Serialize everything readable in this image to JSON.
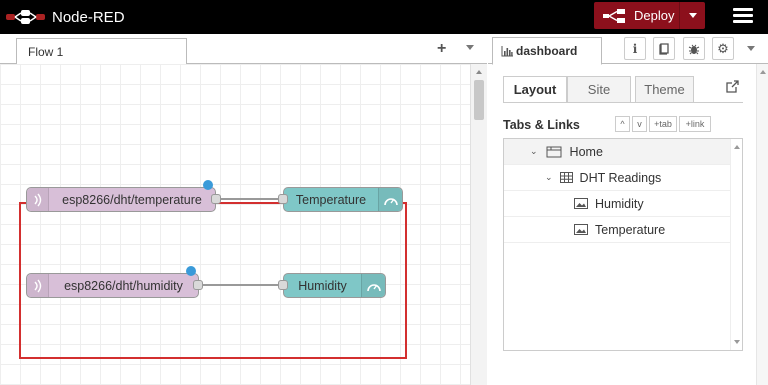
{
  "header": {
    "app_title": "Node-RED",
    "deploy_label": "Deploy"
  },
  "workspace": {
    "flow_tab": "Flow 1",
    "add_tab": "+"
  },
  "nodes": [
    {
      "label": "esp8266/dht/temperature",
      "type": "mqtt-in"
    },
    {
      "label": "Temperature",
      "type": "gauge"
    },
    {
      "label": "esp8266/dht/humidity",
      "type": "mqtt-in"
    },
    {
      "label": "Humidity",
      "type": "gauge"
    }
  ],
  "sidebar": {
    "tab_label": "dashboard",
    "sub_tabs": [
      "Layout",
      "Site",
      "Theme"
    ],
    "active_sub_tab": "Layout",
    "tabs_links_title": "Tabs & Links",
    "toolbar": {
      "collapse": "^",
      "expand": "v",
      "add_tab": "+tab",
      "add_link": "+link"
    },
    "tree": {
      "tab": "Home",
      "group": "DHT Readings",
      "widgets": [
        "Humidity",
        "Temperature"
      ]
    }
  },
  "colors": {
    "header_bg": "#000000",
    "deploy_bg": "#8c101c",
    "mqtt_node": "#d8bfd8",
    "gauge_node": "#7fc7c7",
    "selection": "#d32f2f",
    "status_dot": "#3a9ad9"
  }
}
